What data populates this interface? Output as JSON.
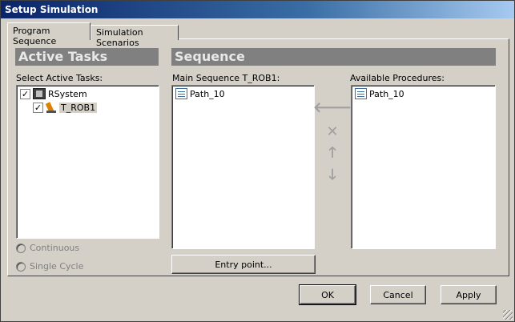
{
  "window": {
    "title": "Setup Simulation"
  },
  "tabs": [
    {
      "label": "Program Sequence",
      "active": true
    },
    {
      "label": "Simulation Scenarios",
      "active": false
    }
  ],
  "active_tasks": {
    "header": "Active Tasks",
    "select_label": "Select Active Tasks:",
    "tree": [
      {
        "label": "RSystem",
        "checked": true,
        "icon": "system-icon"
      },
      {
        "label": "T_ROB1",
        "checked": true,
        "icon": "robot-task-icon"
      }
    ],
    "radio_continuous": "Continuous",
    "radio_single_cycle": "Single Cycle"
  },
  "sequence": {
    "header": "Sequence",
    "main_label": "Main Sequence T_ROB1:",
    "main_items": [
      "Path_10"
    ],
    "available_label": "Available Procedures:",
    "available_items": [
      "Path_10"
    ],
    "entry_point_label": "Entry point...",
    "controls": {
      "add_icon": "arrow-left-icon",
      "remove_icon": "x-icon",
      "move_up_icon": "arrow-up-icon",
      "move_down_icon": "arrow-down-icon"
    }
  },
  "footer": {
    "ok_label": "OK",
    "cancel_label": "Cancel",
    "apply_label": "Apply"
  },
  "colors": {
    "dialog_bg": "#d4d0c8",
    "header_bg": "#808080",
    "title_bar": "#0a246a"
  }
}
